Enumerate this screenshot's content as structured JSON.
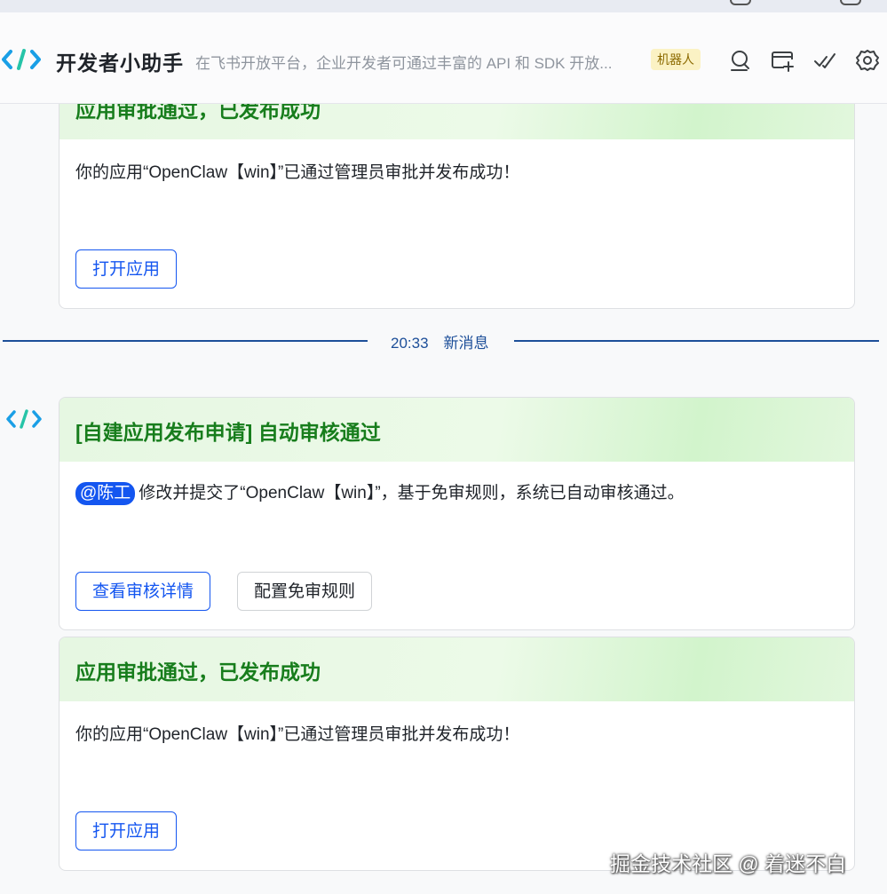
{
  "header": {
    "bot_name": "开发者小助手",
    "bot_desc": "在飞书开放平台，企业开发者可通过丰富的 API 和 SDK 开放...",
    "bot_tag": "机器人"
  },
  "icons": {
    "logo": "developer-assistant-logo",
    "search": "search-icon",
    "add_tab": "add-tab-icon",
    "tasks": "tasks-icon",
    "settings": "gear-icon"
  },
  "messages": {
    "card1": {
      "title": "应用审批通过，已发布成功",
      "text": "你的应用“OpenClaw【win】”已通过管理员审批并发布成功！",
      "button": "打开应用"
    },
    "divider": {
      "label": "20:33　新消息"
    },
    "card2": {
      "title": "[自建应用发布申请] 自动审核通过",
      "mention": "@陈工",
      "text": "修改并提交了“OpenClaw【win】”，基于免审规则，系统已自动审核通过。",
      "button_primary": "查看审核详情",
      "button_secondary": "配置免审规则"
    },
    "card3": {
      "title": "应用审批通过，已发布成功",
      "text": "你的应用“OpenClaw【win】”已通过管理员审批并发布成功！",
      "button": "打开应用"
    }
  },
  "watermark": "掘金技术社区 @ 着迷不白",
  "colors": {
    "accent": "#1456f0",
    "title_green": "#177d1c",
    "divider_blue": "#1d4f99",
    "tag_bg": "#fbf2c4"
  }
}
